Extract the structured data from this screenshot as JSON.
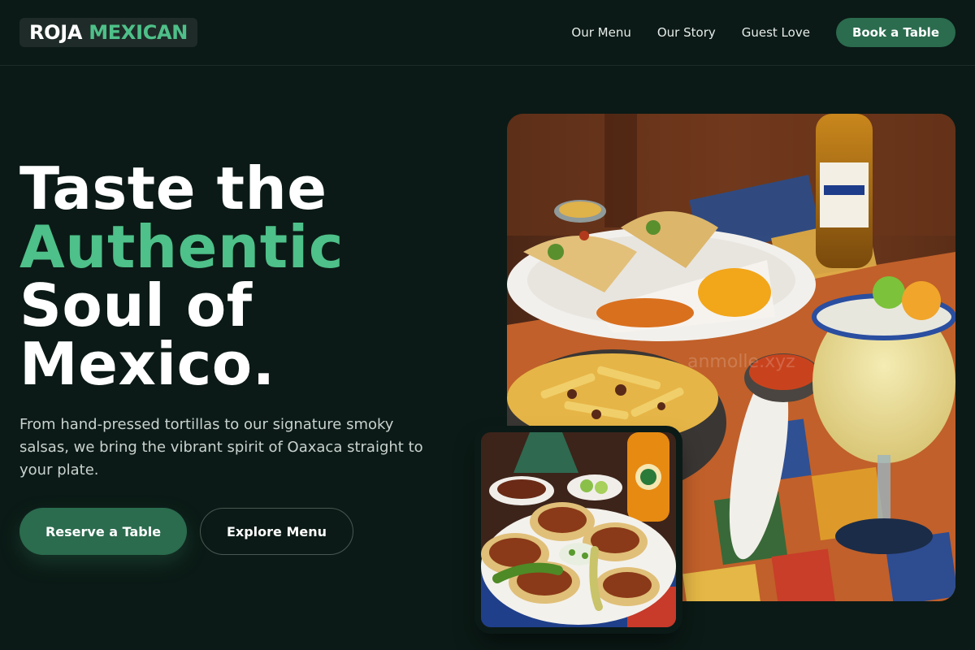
{
  "brand": {
    "name_part1": "ROJA",
    "name_part2": "MEXICAN"
  },
  "nav": {
    "links": [
      {
        "label": "Our Menu"
      },
      {
        "label": "Our Story"
      },
      {
        "label": "Guest Love"
      }
    ],
    "cta_label": "Book a Table"
  },
  "hero": {
    "title_line1": "Taste the",
    "title_line2": "Authentic",
    "title_line3": "Soul of",
    "title_line4": "Mexico.",
    "subtitle": "From hand-pressed tortillas to our signature smoky salsas, we bring the vibrant spirit of Oaxaca straight to your plate.",
    "primary_button": "Reserve a Table",
    "secondary_button": "Explore Menu"
  },
  "colors": {
    "background": "#0b1a16",
    "accent_green": "#4ec089",
    "button_green": "#2b6b4e"
  },
  "images": {
    "main": "mexican-food-spread-photo",
    "secondary": "tacos-plate-photo"
  }
}
